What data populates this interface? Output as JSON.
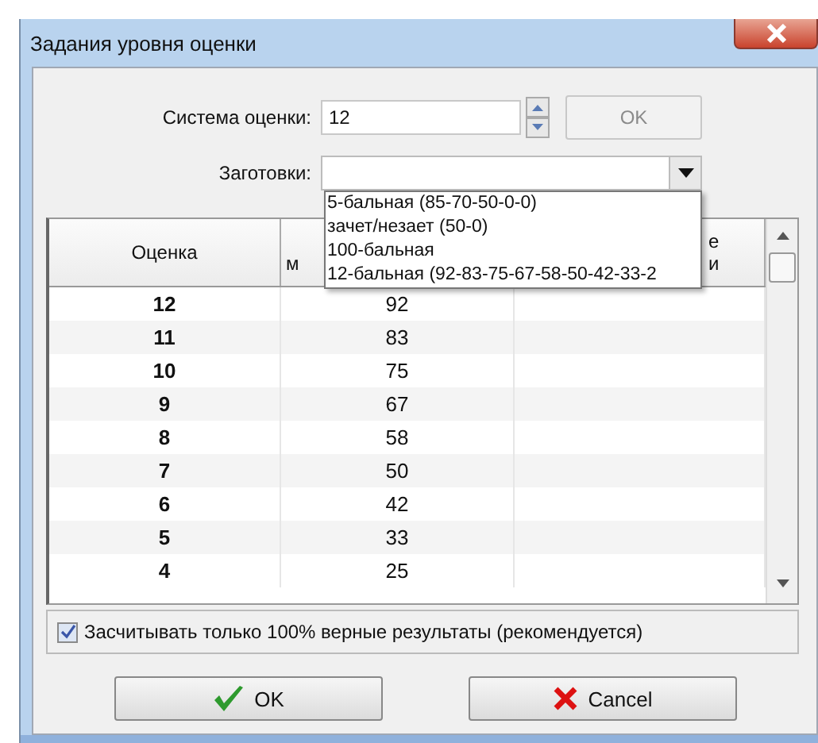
{
  "window": {
    "title": "Задания уровня оценки"
  },
  "grading_system": {
    "label": "Система оценки:",
    "value": "12",
    "apply_button": {
      "label": "OK",
      "disabled": true
    }
  },
  "presets": {
    "label": "Заготовки:",
    "expanded": true,
    "options": [
      {
        "label": "5-бальная (85-70-50-0-0)"
      },
      {
        "label": "зачет/незает (50-0)"
      },
      {
        "label": "100-бальная"
      },
      {
        "label": "12-бальная (92-83-75-67-58-50-42-33-2"
      }
    ]
  },
  "table": {
    "columns": [
      {
        "lines": [
          "Оценка"
        ]
      },
      {
        "lines": [
          "м"
        ]
      },
      {
        "lines": [
          "е",
          "и"
        ]
      }
    ],
    "rows": [
      {
        "grade": "12",
        "threshold": "92"
      },
      {
        "grade": "11",
        "threshold": "83"
      },
      {
        "grade": "10",
        "threshold": "75"
      },
      {
        "grade": "9",
        "threshold": "67"
      },
      {
        "grade": "8",
        "threshold": "58"
      },
      {
        "grade": "7",
        "threshold": "50"
      },
      {
        "grade": "6",
        "threshold": "42"
      },
      {
        "grade": "5",
        "threshold": "33"
      },
      {
        "grade": "4",
        "threshold": "25"
      }
    ]
  },
  "only_full_results": {
    "label": "Засчитывать только 100% верные результаты (рекомендуется)",
    "checked": true
  },
  "buttons": [
    {
      "label": "OK",
      "kind": "ok"
    },
    {
      "label": "Cancel",
      "kind": "cancel"
    }
  ]
}
